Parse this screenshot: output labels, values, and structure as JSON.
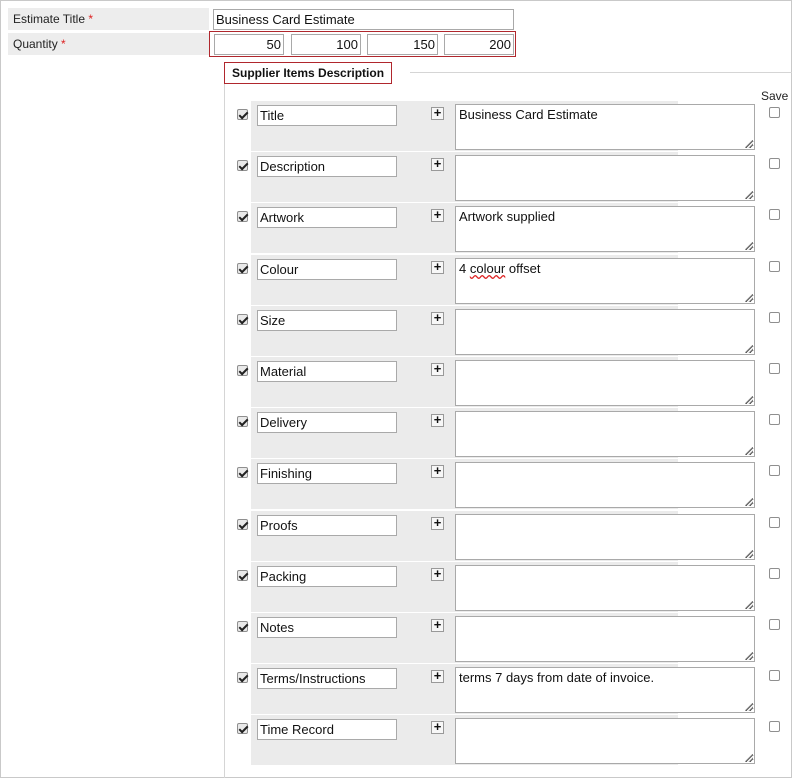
{
  "estimate": {
    "title_label": "Estimate Title",
    "title_value": "Business Card Estimate",
    "quantity_label": "Quantity",
    "required_mark": "*",
    "quantities": [
      "50",
      "100",
      "150",
      "200"
    ]
  },
  "supplier_items": {
    "legend": "Supplier Items Description",
    "save_header": "Save",
    "rows": [
      {
        "name": "Title",
        "included": true,
        "description": "Business Card Estimate",
        "save": false
      },
      {
        "name": "Description",
        "included": true,
        "description": "",
        "save": false
      },
      {
        "name": "Artwork",
        "included": true,
        "description": "Artwork supplied",
        "save": false
      },
      {
        "name": "Colour",
        "included": true,
        "description": "4 colour offset",
        "save": false
      },
      {
        "name": "Size",
        "included": true,
        "description": "",
        "save": false
      },
      {
        "name": "Material",
        "included": true,
        "description": "",
        "save": false
      },
      {
        "name": "Delivery",
        "included": true,
        "description": "",
        "save": false
      },
      {
        "name": "Finishing",
        "included": true,
        "description": "",
        "save": false
      },
      {
        "name": "Proofs",
        "included": true,
        "description": "",
        "save": false
      },
      {
        "name": "Packing",
        "included": true,
        "description": "",
        "save": false
      },
      {
        "name": "Notes",
        "included": true,
        "description": "",
        "save": false
      },
      {
        "name": "Terms/Instructions",
        "included": true,
        "description": "terms 7 days from date of invoice.",
        "save": false
      },
      {
        "name": "Time Record",
        "included": true,
        "description": "",
        "save": false
      }
    ],
    "add_symbol": "+"
  },
  "colors": {
    "accent_border": "#b0272d",
    "required": "#dd2222",
    "row_bg": "#ebebeb"
  }
}
